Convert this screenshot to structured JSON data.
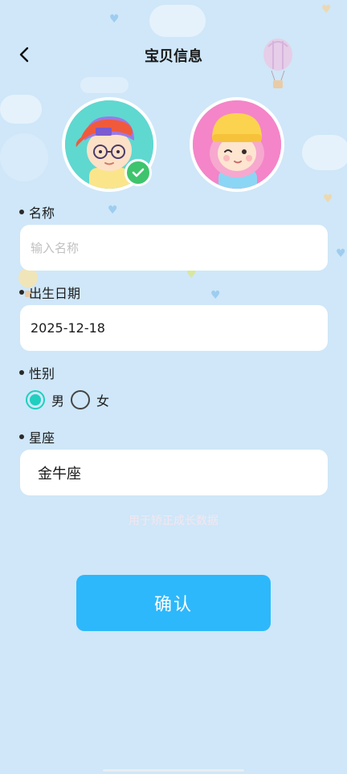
{
  "header": {
    "title": "宝贝信息",
    "back_icon": "chevron-left-icon"
  },
  "avatars": [
    {
      "name": "boy",
      "selected": true
    },
    {
      "name": "girl",
      "selected": false
    }
  ],
  "form": {
    "name": {
      "label": "名称",
      "value": "",
      "placeholder": "输入名称"
    },
    "birthdate": {
      "label": "出生日期",
      "value": "2025-12-18"
    },
    "gender": {
      "label": "性别",
      "options": [
        "男",
        "女"
      ],
      "selected": "男"
    },
    "zodiac": {
      "label": "星座",
      "value": "金牛座"
    },
    "hint": "用于矫正成长数据"
  },
  "actions": {
    "confirm_label": "确认"
  },
  "colors": {
    "accent": "#2db8fb",
    "radio": "#1fcfbf",
    "check": "#3ec46d",
    "background": "#cfe7f8"
  }
}
